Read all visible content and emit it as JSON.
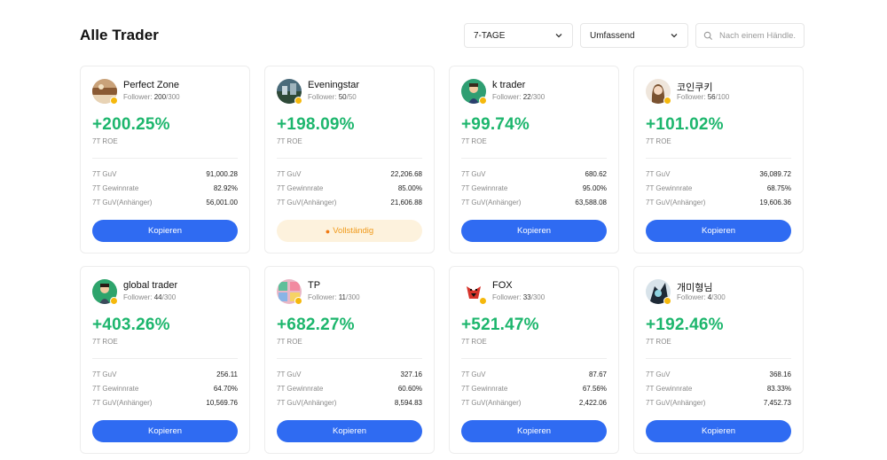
{
  "title": "Alle Trader",
  "filters": {
    "period": "7-TAGE",
    "sort": "Umfassend",
    "search_placeholder": "Nach einem Händle..."
  },
  "labels": {
    "followers": "Follower:",
    "roe": "7T ROE",
    "pnl": "7T GuV",
    "winrate": "7T Gewinnrate",
    "follower_pnl": "7T GuV(Anhänger)"
  },
  "traders": [
    {
      "name": "Perfect Zone",
      "followers": "200",
      "max": "/300",
      "roe": "+200.25%",
      "pnl": "91,000.28",
      "winrate": "82.92%",
      "follower_pnl": "56,001.00",
      "button": "Kopieren"
    },
    {
      "name": "Eveningstar",
      "followers": "50",
      "max": "/50",
      "roe": "+198.09%",
      "pnl": "22,206.68",
      "winrate": "85.00%",
      "follower_pnl": "21,606.88",
      "button": "Vollständig"
    },
    {
      "name": "k trader",
      "followers": "22",
      "max": "/300",
      "roe": "+99.74%",
      "pnl": "680.62",
      "winrate": "95.00%",
      "follower_pnl": "63,588.08",
      "button": "Kopieren"
    },
    {
      "name": "코인쿠키",
      "followers": "56",
      "max": "/100",
      "roe": "+101.02%",
      "pnl": "36,089.72",
      "winrate": "68.75%",
      "follower_pnl": "19,606.36",
      "button": "Kopieren"
    },
    {
      "name": "global trader",
      "followers": "44",
      "max": "/300",
      "roe": "+403.26%",
      "pnl": "256.11",
      "winrate": "64.70%",
      "follower_pnl": "10,569.76",
      "button": "Kopieren"
    },
    {
      "name": "TP",
      "followers": "11",
      "max": "/300",
      "roe": "+682.27%",
      "pnl": "327.16",
      "winrate": "60.60%",
      "follower_pnl": "8,594.83",
      "button": "Kopieren"
    },
    {
      "name": "FOX",
      "followers": "33",
      "max": "/300",
      "roe": "+521.47%",
      "pnl": "87.67",
      "winrate": "67.56%",
      "follower_pnl": "2,422.06",
      "button": "Kopieren"
    },
    {
      "name": "개미형님",
      "followers": "4",
      "max": "/300",
      "roe": "+192.46%",
      "pnl": "368.16",
      "winrate": "83.33%",
      "follower_pnl": "7,452.73",
      "button": "Kopieren"
    }
  ],
  "colors": {
    "roe_green": "#1db66d",
    "button_blue": "#2f6bf2",
    "full_bg": "#fdf2dd",
    "full_text": "#f09a1b",
    "badge_gold": "#f5b80c"
  },
  "icons": {
    "chevron": "chevron-down-icon",
    "search": "search-icon",
    "full": "flame-icon",
    "badge": "verified-badge-icon"
  }
}
